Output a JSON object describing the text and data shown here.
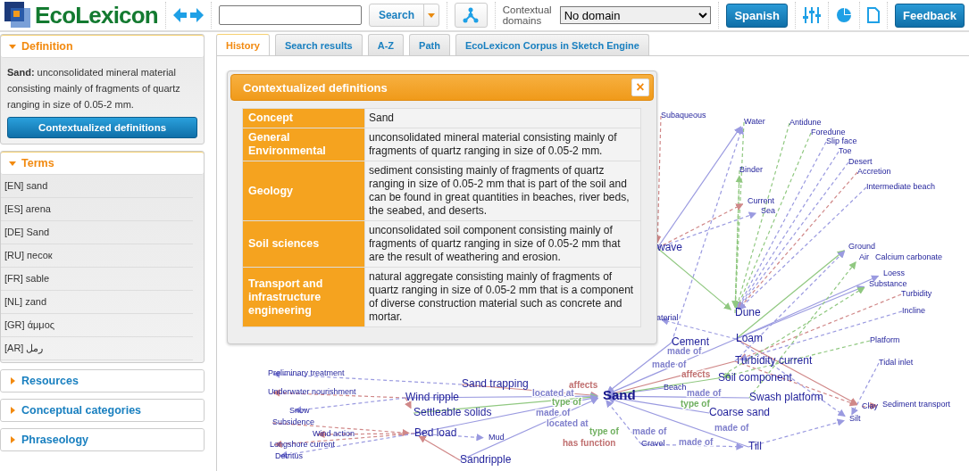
{
  "header": {
    "logo_text": "EcoLexicon",
    "search_button": "Search",
    "contextual_domains": {
      "label": "Contextual domains",
      "value": "No domain"
    },
    "language_button": "Spanish",
    "feedback_button": "Feedback"
  },
  "sidebar": {
    "panels": [
      {
        "kind": "definition",
        "title": "Definition",
        "expanded": true,
        "text": "**Sand:** unconsolidated mineral material consisting mainly of fragments of quartz ranging in size of 0.05-2 mm.",
        "button": "Contextualized definitions"
      },
      {
        "kind": "terms",
        "title": "Terms",
        "expanded": true,
        "items": [
          "[EN] sand",
          "[ES] arena",
          "[DE] Sand",
          "[RU] песок",
          "[FR] sable",
          "[NL] zand",
          "[GR] άμμος",
          "[AR] رمل"
        ]
      },
      {
        "title": "Resources",
        "expanded": false
      },
      {
        "title": "Conceptual categories",
        "expanded": false
      },
      {
        "title": "Phraseology",
        "expanded": false
      }
    ]
  },
  "tabs": [
    {
      "label": "History",
      "selected": true
    },
    {
      "label": "Search results",
      "selected": false
    },
    {
      "label": "A-Z",
      "selected": false
    },
    {
      "label": "Path",
      "selected": false
    },
    {
      "label": "EcoLexicon Corpus in Sketch Engine",
      "selected": false
    }
  ],
  "dialog": {
    "title": "Contextualized definitions",
    "close": "×",
    "rows": [
      {
        "label": "Concept",
        "value": "Sand"
      },
      {
        "label": "General Environmental",
        "value": "unconsolidated mineral material consisting mainly of fragments of quartz ranging in size of 0.05-2 mm."
      },
      {
        "label": "Geology",
        "value": "sediment consisting mainly of fragments of quartz ranging in size of 0.05-2 mm that is part of the soil and can be found in great quantities in beaches, river beds, the seabed, and deserts."
      },
      {
        "label": "Soil sciences",
        "value": "unconsolidated soil component consisting mainly of fragments of quartz ranging in size of 0.05-2 mm that are the result of weathering and erosion."
      },
      {
        "label": "Transport and infrastructure engineering",
        "value": "natural aggregate consisting mainly of fragments of quartz ranging in size of 0.05-2 mm that is a component of diverse construction material such as concrete and mortar."
      }
    ]
  },
  "graph": {
    "nodes": [
      {
        "label": "Subaqueous",
        "kind": "minor"
      },
      {
        "label": "Water",
        "kind": "minor"
      },
      {
        "label": "Antidune",
        "kind": "minor"
      },
      {
        "label": "Foredune",
        "kind": "minor"
      },
      {
        "label": "Slip face",
        "kind": "minor"
      },
      {
        "label": "Toe",
        "kind": "minor"
      },
      {
        "label": "Desert",
        "kind": "minor"
      },
      {
        "label": "Accretion",
        "kind": "minor"
      },
      {
        "label": "Intermediate beach",
        "kind": "minor"
      },
      {
        "label": "Binder",
        "kind": "minor"
      },
      {
        "label": "Current",
        "kind": "minor"
      },
      {
        "label": "Sea",
        "kind": "minor"
      },
      {
        "label": "wave",
        "kind": "major"
      },
      {
        "label": "Ground",
        "kind": "minor"
      },
      {
        "label": "Air",
        "kind": "minor"
      },
      {
        "label": "Calcium carbonate",
        "kind": "minor"
      },
      {
        "label": "Loess",
        "kind": "minor"
      },
      {
        "label": "Substance",
        "kind": "minor"
      },
      {
        "label": "Turbidity",
        "kind": "minor"
      },
      {
        "label": "Incline",
        "kind": "minor"
      },
      {
        "label": "Dune",
        "kind": "major"
      },
      {
        "label": "aterial",
        "kind": "minor"
      },
      {
        "label": "Cement",
        "kind": "major"
      },
      {
        "label": "Loam",
        "kind": "major"
      },
      {
        "label": "Platform",
        "kind": "minor"
      },
      {
        "label": "Turbidity current",
        "kind": "major"
      },
      {
        "label": "Tidal inlet",
        "kind": "minor"
      },
      {
        "label": "Soil component",
        "kind": "major"
      },
      {
        "label": "Swash platform",
        "kind": "major"
      },
      {
        "label": "Clay",
        "kind": "minor"
      },
      {
        "label": "Sediment transport",
        "kind": "minor"
      },
      {
        "label": "Silt",
        "kind": "minor"
      },
      {
        "label": "Coarse sand",
        "kind": "major"
      },
      {
        "label": "Till",
        "kind": "major"
      },
      {
        "label": "Beach",
        "kind": "minor"
      },
      {
        "label": "Gravel",
        "kind": "minor"
      },
      {
        "label": "Preliminary treatment",
        "kind": "minor"
      },
      {
        "label": "Underwater nourishment",
        "kind": "minor"
      },
      {
        "label": "Snow",
        "kind": "minor"
      },
      {
        "label": "Subsidence",
        "kind": "minor"
      },
      {
        "label": "Wind action",
        "kind": "minor"
      },
      {
        "label": "Longshore current",
        "kind": "minor"
      },
      {
        "label": "Detritus",
        "kind": "minor"
      },
      {
        "label": "Sand trapping",
        "kind": "major"
      },
      {
        "label": "Wind ripple",
        "kind": "major"
      },
      {
        "label": "Settleable solids",
        "kind": "major"
      },
      {
        "label": "Bed load",
        "kind": "major"
      },
      {
        "label": "Mud",
        "kind": "minor"
      },
      {
        "label": "Sandripple",
        "kind": "major"
      },
      {
        "label": "Sand",
        "kind": "focus"
      }
    ],
    "edge_labels": [
      {
        "text": "made of",
        "color": "#8080cc"
      },
      {
        "text": "made of",
        "color": "#8080cc"
      },
      {
        "text": "affects",
        "color": "#c07070"
      },
      {
        "text": "affects",
        "color": "#c07070"
      },
      {
        "text": "located at",
        "color": "#8080cc"
      },
      {
        "text": "made of",
        "color": "#8080cc"
      },
      {
        "text": "type of",
        "color": "#70b060"
      },
      {
        "text": "type of",
        "color": "#70b060"
      },
      {
        "text": "made of",
        "color": "#8080cc"
      },
      {
        "text": "located at",
        "color": "#8080cc"
      },
      {
        "text": "made of",
        "color": "#8080cc"
      },
      {
        "text": "type of",
        "color": "#70b060"
      },
      {
        "text": "made of",
        "color": "#8080cc"
      },
      {
        "text": "has function",
        "color": "#c07070"
      },
      {
        "text": "made of",
        "color": "#8080cc"
      }
    ]
  }
}
